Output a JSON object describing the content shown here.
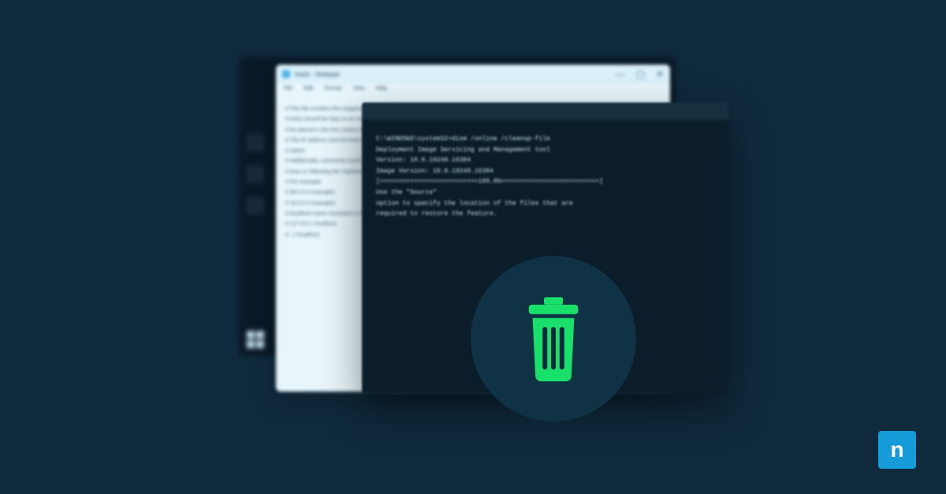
{
  "brand_letter": "n",
  "notepad": {
    "title": "hosts - Notepad",
    "menu": [
      "File",
      "Edit",
      "Format",
      "View",
      "Help"
    ],
    "window_controls": {
      "min": "—",
      "max": "▢",
      "close": "✕"
    },
    "lines": [
      "# This file contains the mappings of IP addresses to host names. Each",
      "# entry should be kept on an individual",
      "# be placed in the first column follo",
      "# The IP address and the host name sh",
      "# space.",
      "# Additionally, comments (such as the",
      "# lines or following the machine name",
      "# For example:",
      "#      38.0.0.0      example1",
      "#      10.0.0.0      example2",
      "# localhost name resolution is handle",
      "#     127.0.0.1      localhost",
      "#     ::1            localhost"
    ]
  },
  "terminal": {
    "lines": [
      "C:\\WINDOWS\\system32>dism /online /cleanup-file",
      "",
      "Deployment Image Servicing and Management tool",
      "Version: 10.0.19249.16384",
      "",
      "Image Version: 10.0.19249.16384",
      "",
      "[==========================100.0%==========================]",
      "",
      "Use the \"Source\"",
      "option to specify the location of the files that are",
      "required to restore the feature."
    ]
  },
  "icon_names": {
    "windows": "windows-logo-icon",
    "trash": "trash-icon",
    "file": "file-icon"
  }
}
